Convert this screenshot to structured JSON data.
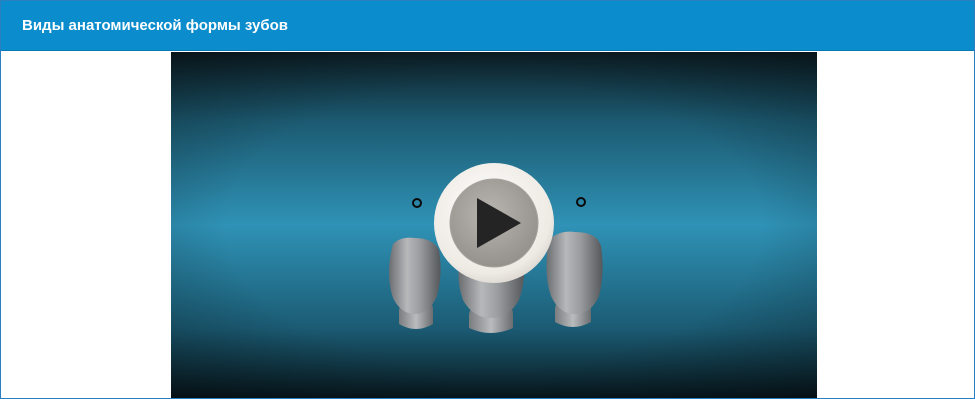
{
  "panel": {
    "title": "Виды анатомической формы зубов"
  },
  "video": {
    "play_icon": "play-icon",
    "colors": {
      "header": "#0b8ccd",
      "video_center": "#2e8fb3",
      "video_edge": "#0a1a20"
    }
  }
}
